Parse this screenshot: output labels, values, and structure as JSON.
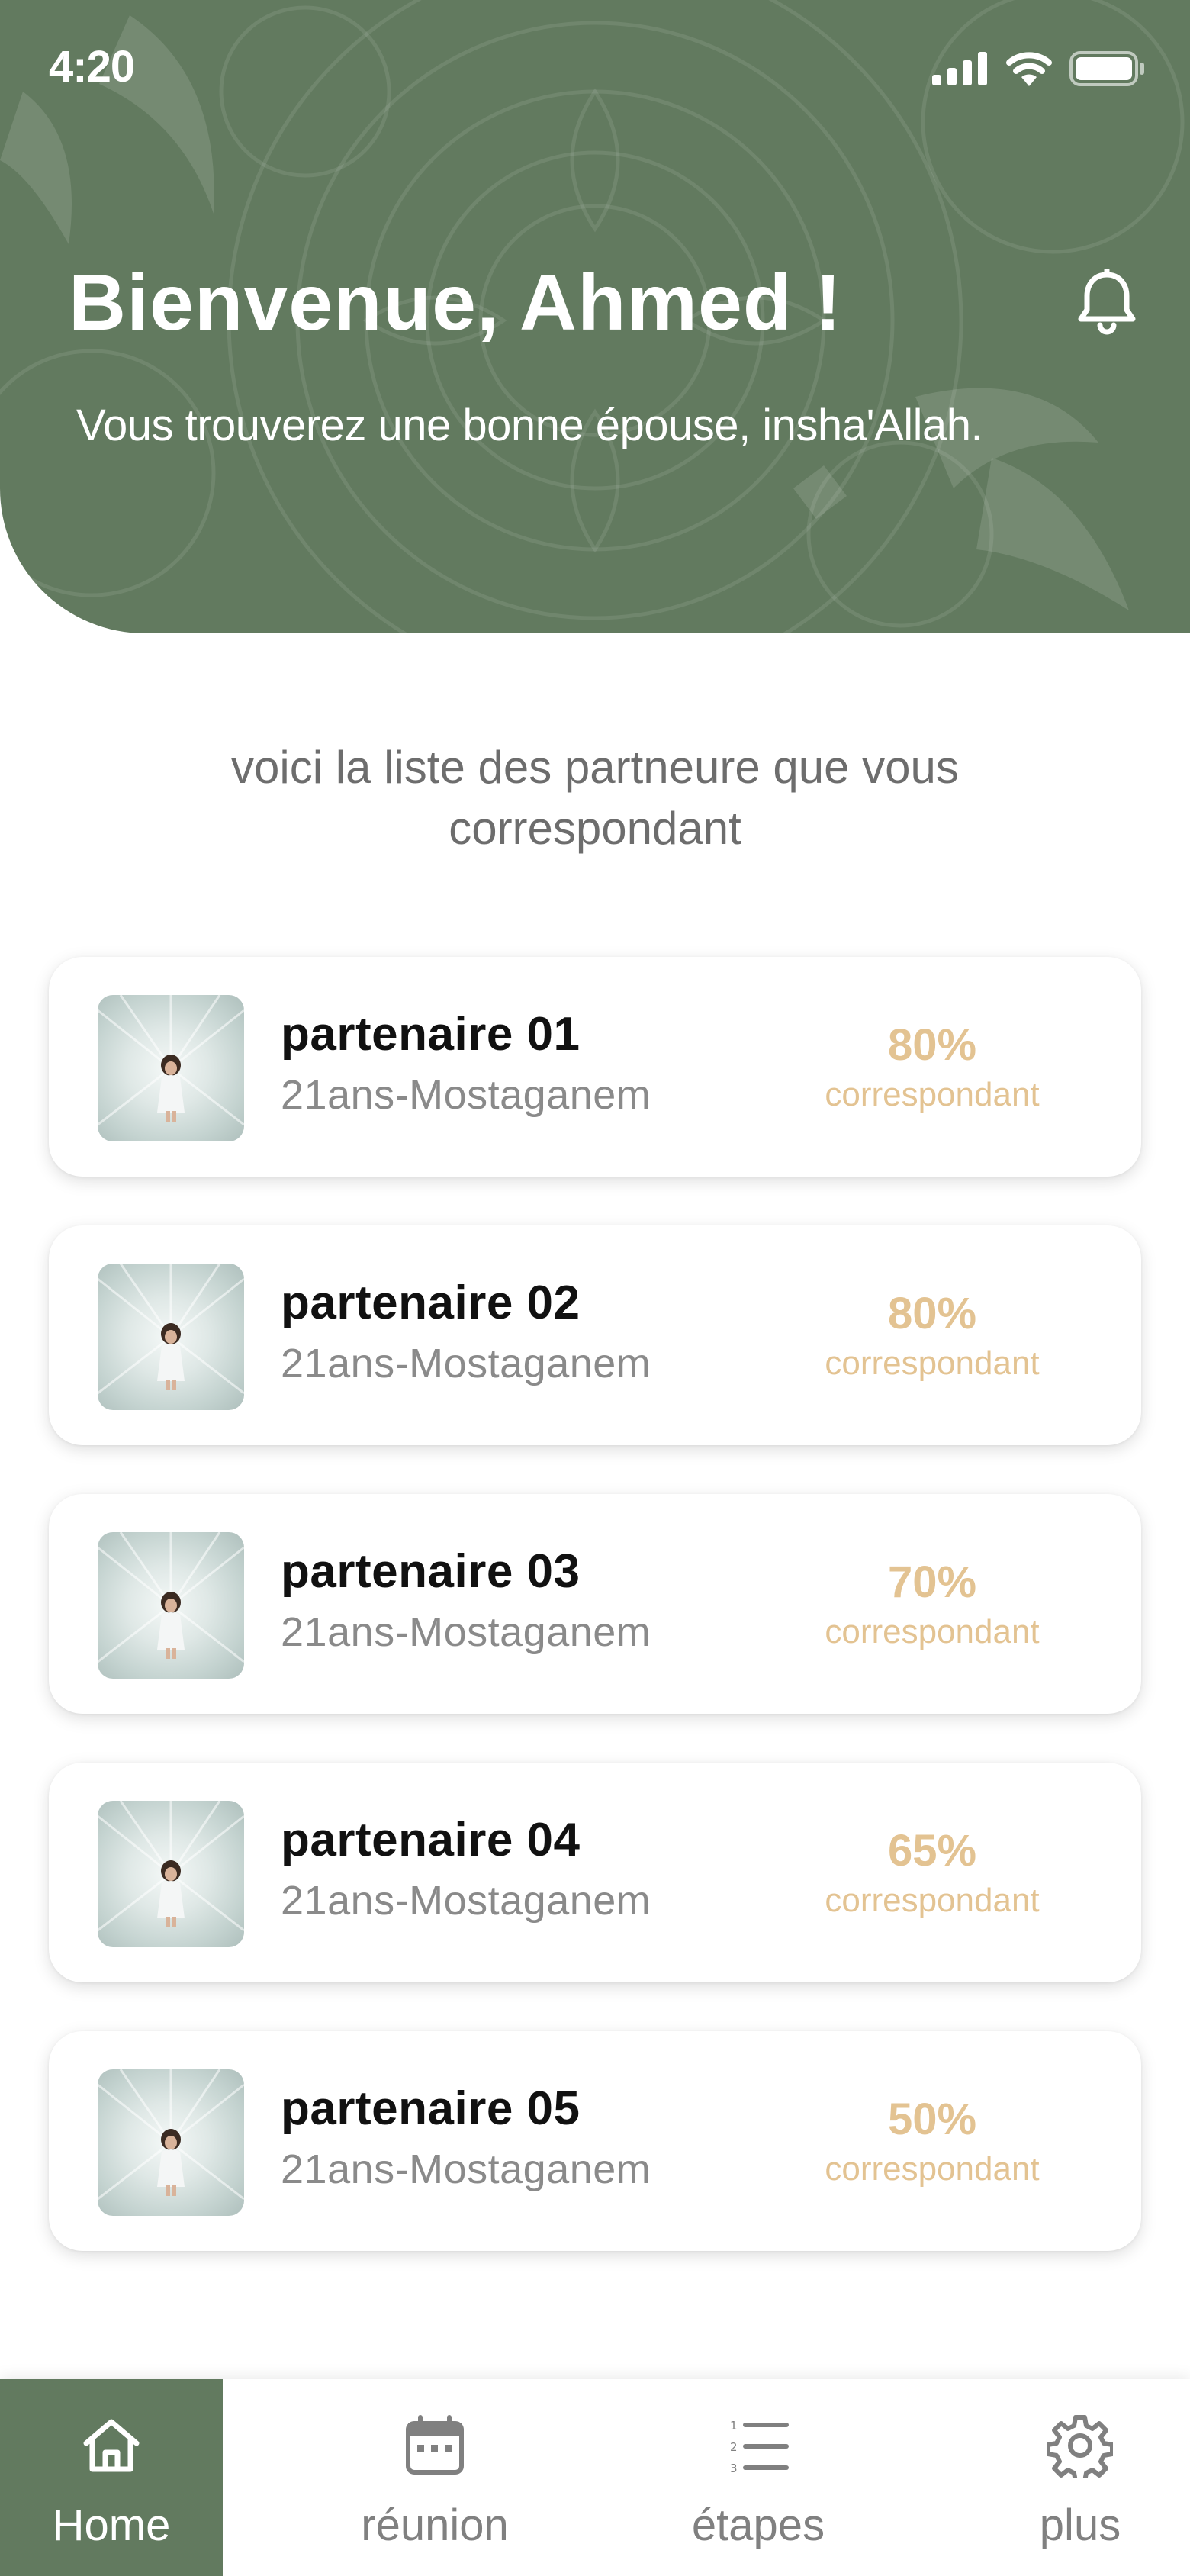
{
  "status_bar": {
    "time": "4:20",
    "icons": [
      "signal-icon",
      "wifi-icon",
      "battery-icon"
    ]
  },
  "header": {
    "greeting": "Bienvenue, Ahmed !",
    "subtitle": "Vous trouverez une bonne épouse, insha'Allah.",
    "notification_icon": "bell-icon"
  },
  "intro": {
    "line1": "voici la liste des partneure que vous",
    "line2": "correspondant"
  },
  "partners": [
    {
      "name": "partenaire 01",
      "details": "21ans-Mostaganem",
      "match": "80%",
      "match_label": "correspondant"
    },
    {
      "name": "partenaire 02",
      "details": "21ans-Mostaganem",
      "match": "80%",
      "match_label": "correspondant"
    },
    {
      "name": "partenaire 03",
      "details": "21ans-Mostaganem",
      "match": "70%",
      "match_label": "correspondant"
    },
    {
      "name": "partenaire 04",
      "details": "21ans-Mostaganem",
      "match": "65%",
      "match_label": "correspondant"
    },
    {
      "name": "partenaire 05",
      "details": "21ans-Mostaganem",
      "match": "50%",
      "match_label": "correspondant"
    }
  ],
  "tabs": [
    {
      "label": "Home",
      "icon": "home-icon",
      "active": true
    },
    {
      "label": "réunion",
      "icon": "calendar-icon",
      "active": false
    },
    {
      "label": "étapes",
      "icon": "numbered-list-icon",
      "active": false
    },
    {
      "label": "plus",
      "icon": "gear-icon",
      "active": false
    }
  ],
  "colors": {
    "primary_green": "#627a5f",
    "accent_gold": "#e3c392",
    "text_gray": "#8a8a8a",
    "tab_inactive": "#808080"
  }
}
